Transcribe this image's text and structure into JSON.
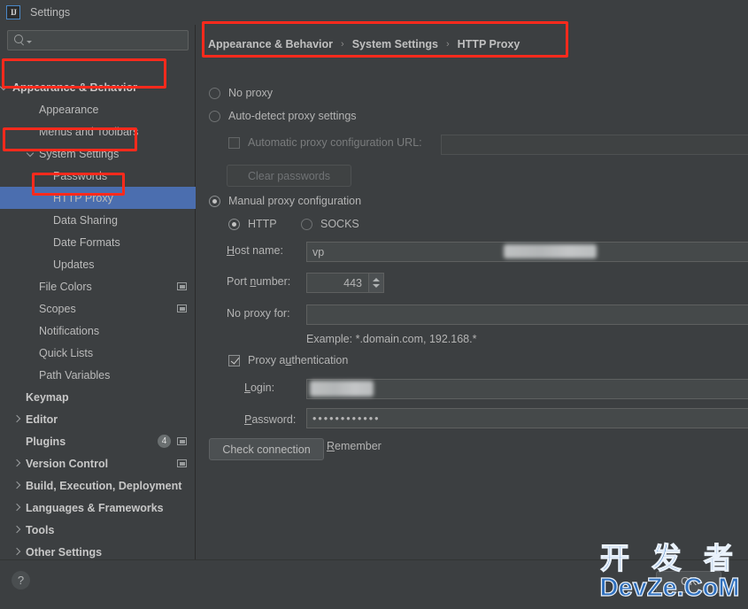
{
  "window": {
    "title": "Settings",
    "app_icon": "intellij-idea-icon",
    "accent_selection": "#4b6eaf",
    "annotation_color": "#ff2a1c",
    "background": "#3c3f41"
  },
  "search": {
    "placeholder": "",
    "value": "",
    "icon": "search-icon"
  },
  "sidebar": {
    "items": [
      {
        "label": "Appearance & Behavior",
        "indent": 14,
        "bold": true,
        "arrow": "down",
        "selected": false,
        "scope_icon": false
      },
      {
        "label": "Appearance",
        "indent": 44,
        "bold": false,
        "arrow": "none",
        "selected": false,
        "scope_icon": false
      },
      {
        "label": "Menus and Toolbars",
        "indent": 44,
        "bold": false,
        "arrow": "none",
        "selected": false,
        "scope_icon": false
      },
      {
        "label": "System Settings",
        "indent": 44,
        "bold": false,
        "arrow": "down",
        "selected": false,
        "scope_icon": false
      },
      {
        "label": "Passwords",
        "indent": 60,
        "bold": false,
        "arrow": "none",
        "selected": false,
        "scope_icon": false
      },
      {
        "label": "HTTP Proxy",
        "indent": 60,
        "bold": false,
        "arrow": "none",
        "selected": true,
        "scope_icon": false
      },
      {
        "label": "Data Sharing",
        "indent": 60,
        "bold": false,
        "arrow": "none",
        "selected": false,
        "scope_icon": false
      },
      {
        "label": "Date Formats",
        "indent": 60,
        "bold": false,
        "arrow": "none",
        "selected": false,
        "scope_icon": false
      },
      {
        "label": "Updates",
        "indent": 60,
        "bold": false,
        "arrow": "none",
        "selected": false,
        "scope_icon": false
      },
      {
        "label": "File Colors",
        "indent": 44,
        "bold": false,
        "arrow": "none",
        "selected": false,
        "scope_icon": true
      },
      {
        "label": "Scopes",
        "indent": 44,
        "bold": false,
        "arrow": "none",
        "selected": false,
        "scope_icon": true
      },
      {
        "label": "Notifications",
        "indent": 44,
        "bold": false,
        "arrow": "none",
        "selected": false,
        "scope_icon": false
      },
      {
        "label": "Quick Lists",
        "indent": 44,
        "bold": false,
        "arrow": "none",
        "selected": false,
        "scope_icon": false
      },
      {
        "label": "Path Variables",
        "indent": 44,
        "bold": false,
        "arrow": "none",
        "selected": false,
        "scope_icon": false
      },
      {
        "label": "Keymap",
        "indent": 29,
        "bold": true,
        "arrow": "none",
        "selected": false,
        "scope_icon": false
      },
      {
        "label": "Editor",
        "indent": 29,
        "bold": true,
        "arrow": "right",
        "selected": false,
        "scope_icon": false
      },
      {
        "label": "Plugins",
        "indent": 29,
        "bold": true,
        "arrow": "none",
        "selected": false,
        "scope_icon": true,
        "badge": "4"
      },
      {
        "label": "Version Control",
        "indent": 29,
        "bold": true,
        "arrow": "right",
        "selected": false,
        "scope_icon": true
      },
      {
        "label": "Build, Execution, Deployment",
        "indent": 29,
        "bold": true,
        "arrow": "right",
        "selected": false,
        "scope_icon": false
      },
      {
        "label": "Languages & Frameworks",
        "indent": 29,
        "bold": true,
        "arrow": "right",
        "selected": false,
        "scope_icon": false
      },
      {
        "label": "Tools",
        "indent": 29,
        "bold": true,
        "arrow": "right",
        "selected": false,
        "scope_icon": false
      },
      {
        "label": "Other Settings",
        "indent": 29,
        "bold": true,
        "arrow": "right",
        "selected": false,
        "scope_icon": false
      }
    ]
  },
  "breadcrumb": {
    "parts": [
      "Appearance & Behavior",
      "System Settings",
      "HTTP Proxy"
    ],
    "separator": "›"
  },
  "proxy": {
    "no_proxy_label": "No proxy",
    "no_proxy_selected": false,
    "auto_detect_label": "Auto-detect proxy settings",
    "auto_detect_selected": false,
    "auto_config_url_label": "Automatic proxy configuration URL:",
    "auto_config_url_checked": false,
    "auto_config_url_value": "",
    "clear_passwords_label": "Clear passwords",
    "clear_passwords_enabled": false,
    "manual_label": "Manual proxy configuration",
    "manual_selected": true,
    "http_label": "HTTP",
    "http_selected": true,
    "socks_label": "SOCKS",
    "socks_selected": false,
    "host_name_label": "Host name:",
    "host_name_value": "vp",
    "host_name_redacted": true,
    "port_number_label": "Port number:",
    "port_number_value": "443",
    "no_proxy_for_label": "No proxy for:",
    "no_proxy_for_value": "",
    "example_text": "Example: *.domain.com, 192.168.*",
    "proxy_auth_label": "Proxy authentication",
    "proxy_auth_checked": true,
    "login_label": "Login:",
    "login_value": "",
    "login_redacted": true,
    "password_label": "Password:",
    "password_value": "••••••••••••",
    "remember_label": "Remember",
    "remember_checked": true,
    "check_connection_label": "Check connection"
  },
  "footer": {
    "help_label": "?",
    "ok_label": "OK"
  },
  "watermark": {
    "line1": "开 发 者",
    "line2": "DevZe.CoM"
  }
}
